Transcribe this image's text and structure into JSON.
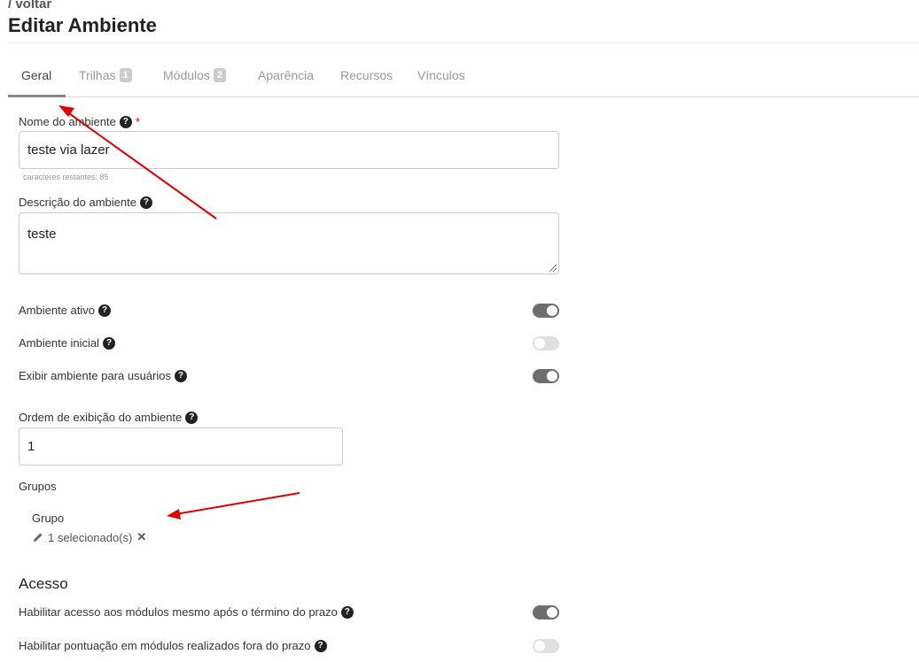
{
  "header": {
    "breadcrumb": "/ voltar",
    "title": "Editar Ambiente"
  },
  "tabs": [
    {
      "label": "Geral",
      "badge": null,
      "active": true
    },
    {
      "label": "Trilhas",
      "badge": "1",
      "active": false
    },
    {
      "label": "Módulos",
      "badge": "2",
      "active": false
    },
    {
      "label": "Aparência",
      "badge": null,
      "active": false
    },
    {
      "label": "Recursos",
      "badge": null,
      "active": false
    },
    {
      "label": "Vínculos",
      "badge": null,
      "active": false
    }
  ],
  "form": {
    "name_label": "Nome do ambiente",
    "required_mark": "*",
    "name_value": "teste via lazer",
    "chars_remaining": "caracteres restantes: 85",
    "description_label": "Descrição do ambiente",
    "description_value": "teste",
    "toggles": [
      {
        "label": "Ambiente ativo",
        "on": true
      },
      {
        "label": "Ambiente inicial",
        "on": false
      },
      {
        "label": "Exibir ambiente para usuários",
        "on": true
      }
    ],
    "order_label": "Ordem de exibição do ambiente",
    "order_value": "1",
    "groups_label": "Grupos",
    "group_label": "Grupo",
    "group_selected": "1 selecionado(s)"
  },
  "access": {
    "title": "Acesso",
    "toggles": [
      {
        "label": "Habilitar acesso aos módulos mesmo após o término do prazo",
        "on": true
      },
      {
        "label": "Habilitar pontuação em módulos realizados fora do prazo",
        "on": false
      }
    ]
  },
  "icons": {
    "help": "question-circle-icon",
    "edit": "pencil-icon",
    "remove": "close-icon"
  },
  "colors": {
    "toggle_on": "#6e6e6e",
    "toggle_off": "#e0e0e0",
    "annotation_arrow": "#e00000",
    "required": "#ee0000"
  }
}
